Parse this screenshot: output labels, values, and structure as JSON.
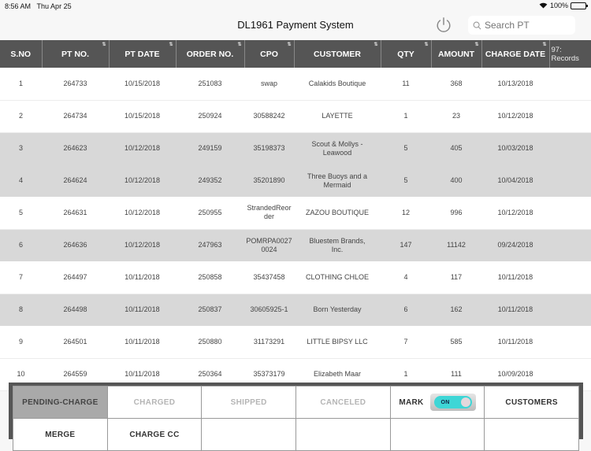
{
  "status_bar": {
    "time": "8:56 AM",
    "date": "Thu Apr 25",
    "battery": "100%"
  },
  "header": {
    "title": "DL1961 Payment System",
    "search_placeholder": "Search PT"
  },
  "table": {
    "columns": [
      "S.NO",
      "PT NO.",
      "PT DATE",
      "ORDER NO.",
      "CPO",
      "CUSTOMER",
      "QTY",
      "AMOUNT",
      "CHARGE DATE"
    ],
    "records_label": "97: Records",
    "rows": [
      {
        "sno": "1",
        "pt_no": "264733",
        "pt_date": "10/15/2018",
        "order_no": "251083",
        "cpo": "swap",
        "customer": "Calakids Boutique",
        "qty": "11",
        "amount": "368",
        "charge_date": "10/13/2018",
        "shade": "white"
      },
      {
        "sno": "2",
        "pt_no": "264734",
        "pt_date": "10/15/2018",
        "order_no": "250924",
        "cpo": "30588242",
        "customer": "LAYETTE",
        "qty": "1",
        "amount": "23",
        "charge_date": "10/12/2018",
        "shade": "white"
      },
      {
        "sno": "3",
        "pt_no": "264623",
        "pt_date": "10/12/2018",
        "order_no": "249159",
        "cpo": "35198373",
        "customer": "Scout & Mollys - Leawood",
        "qty": "5",
        "amount": "405",
        "charge_date": "10/03/2018",
        "shade": "gray"
      },
      {
        "sno": "4",
        "pt_no": "264624",
        "pt_date": "10/12/2018",
        "order_no": "249352",
        "cpo": "35201890",
        "customer": "Three Buoys and a Mermaid",
        "qty": "5",
        "amount": "400",
        "charge_date": "10/04/2018",
        "shade": "gray"
      },
      {
        "sno": "5",
        "pt_no": "264631",
        "pt_date": "10/12/2018",
        "order_no": "250955",
        "cpo": "StrandedReorder",
        "customer": "ZAZOU BOUTIQUE",
        "qty": "12",
        "amount": "996",
        "charge_date": "10/12/2018",
        "shade": "white"
      },
      {
        "sno": "6",
        "pt_no": "264636",
        "pt_date": "10/12/2018",
        "order_no": "247963",
        "cpo": "POMRPA00270024",
        "customer": "Bluestem Brands, Inc.",
        "qty": "147",
        "amount": "11142",
        "charge_date": "09/24/2018",
        "shade": "gray"
      },
      {
        "sno": "7",
        "pt_no": "264497",
        "pt_date": "10/11/2018",
        "order_no": "250858",
        "cpo": "35437458",
        "customer": "CLOTHING CHLOE",
        "qty": "4",
        "amount": "117",
        "charge_date": "10/11/2018",
        "shade": "white"
      },
      {
        "sno": "8",
        "pt_no": "264498",
        "pt_date": "10/11/2018",
        "order_no": "250837",
        "cpo": "30605925-1",
        "customer": "Born Yesterday",
        "qty": "6",
        "amount": "162",
        "charge_date": "10/11/2018",
        "shade": "gray"
      },
      {
        "sno": "9",
        "pt_no": "264501",
        "pt_date": "10/11/2018",
        "order_no": "250880",
        "cpo": "31173291",
        "customer": "LITTLE BIPSY LLC",
        "qty": "7",
        "amount": "585",
        "charge_date": "10/11/2018",
        "shade": "white"
      },
      {
        "sno": "10",
        "pt_no": "264559",
        "pt_date": "10/11/2018",
        "order_no": "250364",
        "cpo": "35373179",
        "customer": "Elizabeth Maar",
        "qty": "1",
        "amount": "111",
        "charge_date": "10/09/2018",
        "shade": "white"
      }
    ]
  },
  "bottom_bar": {
    "pending_charge": "PENDING-CHARGE",
    "charged": "CHARGED",
    "shipped": "SHIPPED",
    "canceled": "CANCELED",
    "mark": "MARK",
    "mark_toggle": "ON",
    "customers": "CUSTOMERS",
    "merge": "MERGE",
    "charge_cc": "CHARGE CC"
  },
  "colors": {
    "header_bg": "#555555",
    "toggle_on": "#3ed6d6",
    "active_tab": "#a9a9a9"
  }
}
